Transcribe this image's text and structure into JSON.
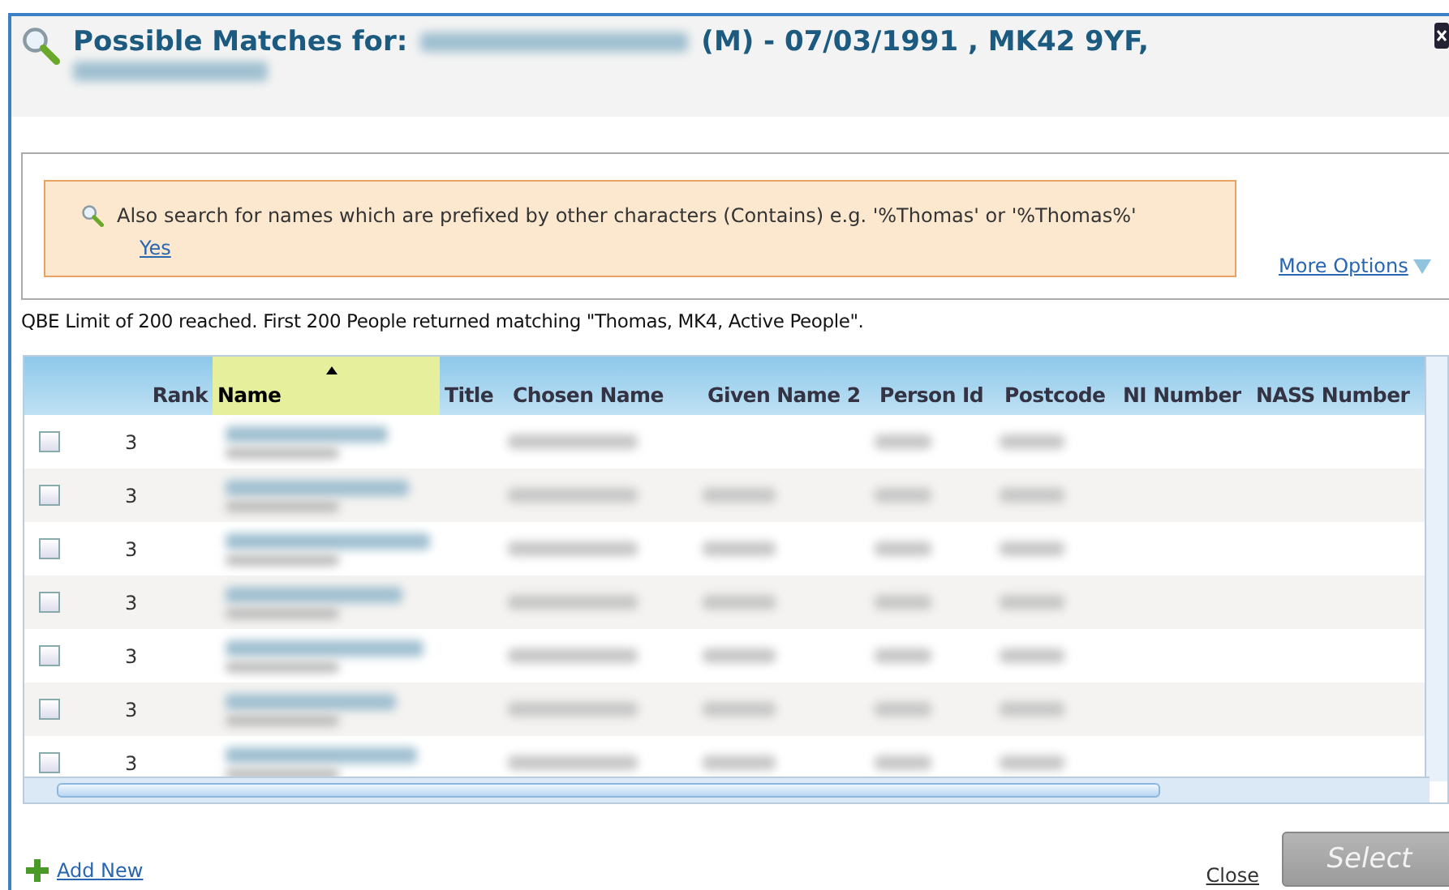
{
  "dialog": {
    "title_prefix": "Possible Matches for:",
    "title_details": "(M) - 07/03/1991 , MK42 9YF,"
  },
  "notice": {
    "text": "Also search for names which are prefixed by other characters (Contains) e.g. '%Thomas' or '%Thomas%'",
    "action": "Yes"
  },
  "more_options": "More Options",
  "status_message": "QBE Limit of 200 reached. First 200 People returned matching \"Thomas, MK4, Active People\".",
  "table": {
    "columns": [
      {
        "label": "Rank",
        "sorted": false
      },
      {
        "label": "Name",
        "sorted": true
      },
      {
        "label": "Title",
        "sorted": false
      },
      {
        "label": "Chosen Name",
        "sorted": false
      },
      {
        "label": "Given Name 2",
        "sorted": false
      },
      {
        "label": "Person Id",
        "sorted": false
      },
      {
        "label": "Postcode",
        "sorted": false
      },
      {
        "label": "NI Number",
        "sorted": false
      },
      {
        "label": "NASS Number",
        "sorted": false
      }
    ],
    "rows": [
      {
        "rank": "3",
        "checked": false
      },
      {
        "rank": "3",
        "checked": false
      },
      {
        "rank": "3",
        "checked": false
      },
      {
        "rank": "3",
        "checked": false
      },
      {
        "rank": "3",
        "checked": false
      },
      {
        "rank": "3",
        "checked": false
      },
      {
        "rank": "3",
        "checked": false
      }
    ]
  },
  "footer": {
    "add_new": "Add New",
    "close": "Close",
    "select": "Select"
  }
}
